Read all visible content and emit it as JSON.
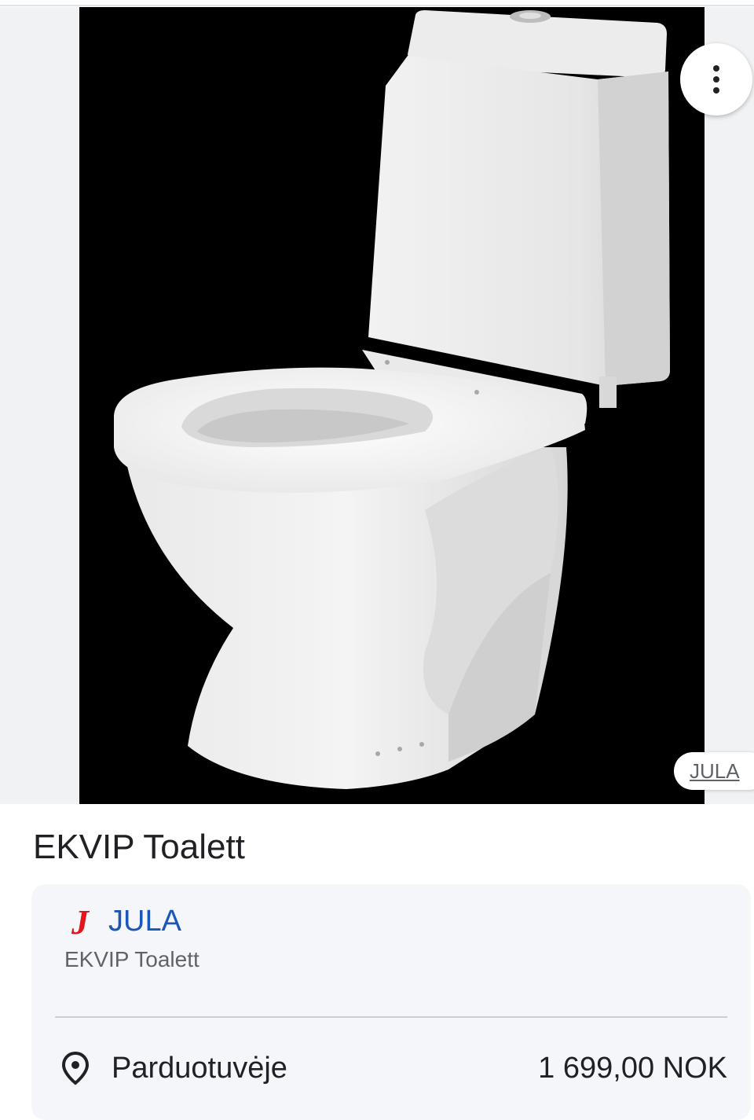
{
  "image": {
    "alt": "EKVIP Toalett",
    "more_options_icon": "more-vert-icon",
    "source_chip_label": "JULA"
  },
  "product": {
    "title": "EKVIP Toalett"
  },
  "offer": {
    "merchant_logo_letter": "J",
    "merchant_logo_color": "#e3151b",
    "merchant_name": "JULA",
    "merchant_name_color": "#1a57b8",
    "subtitle": "EKVIP Toalett",
    "availability_icon": "location-pin-icon",
    "availability": "Parduotuvėje",
    "price": "1 699,00 NOK"
  }
}
